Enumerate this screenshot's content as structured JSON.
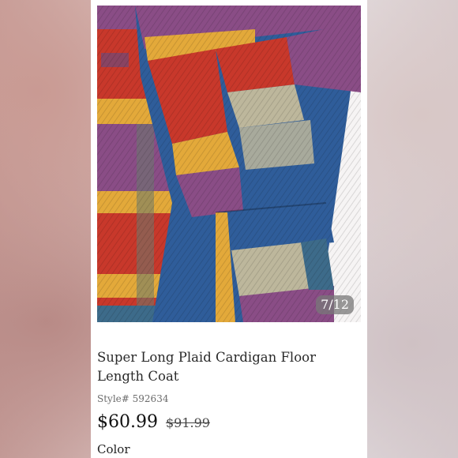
{
  "gallery": {
    "counter": "7/12"
  },
  "product": {
    "title": "Super Long Plaid Cardigan Floor Length Coat",
    "style_label": "Style#",
    "style_number": "592634",
    "price": "$60.99",
    "original_price": "$91.99",
    "color_label": "Color"
  },
  "colors": {
    "plaid_red": "#c8382b",
    "plaid_yellow": "#e3a93a",
    "plaid_purple": "#8a4d86",
    "plaid_blue": "#2f5d9a",
    "plaid_beige": "#bdb79c"
  }
}
